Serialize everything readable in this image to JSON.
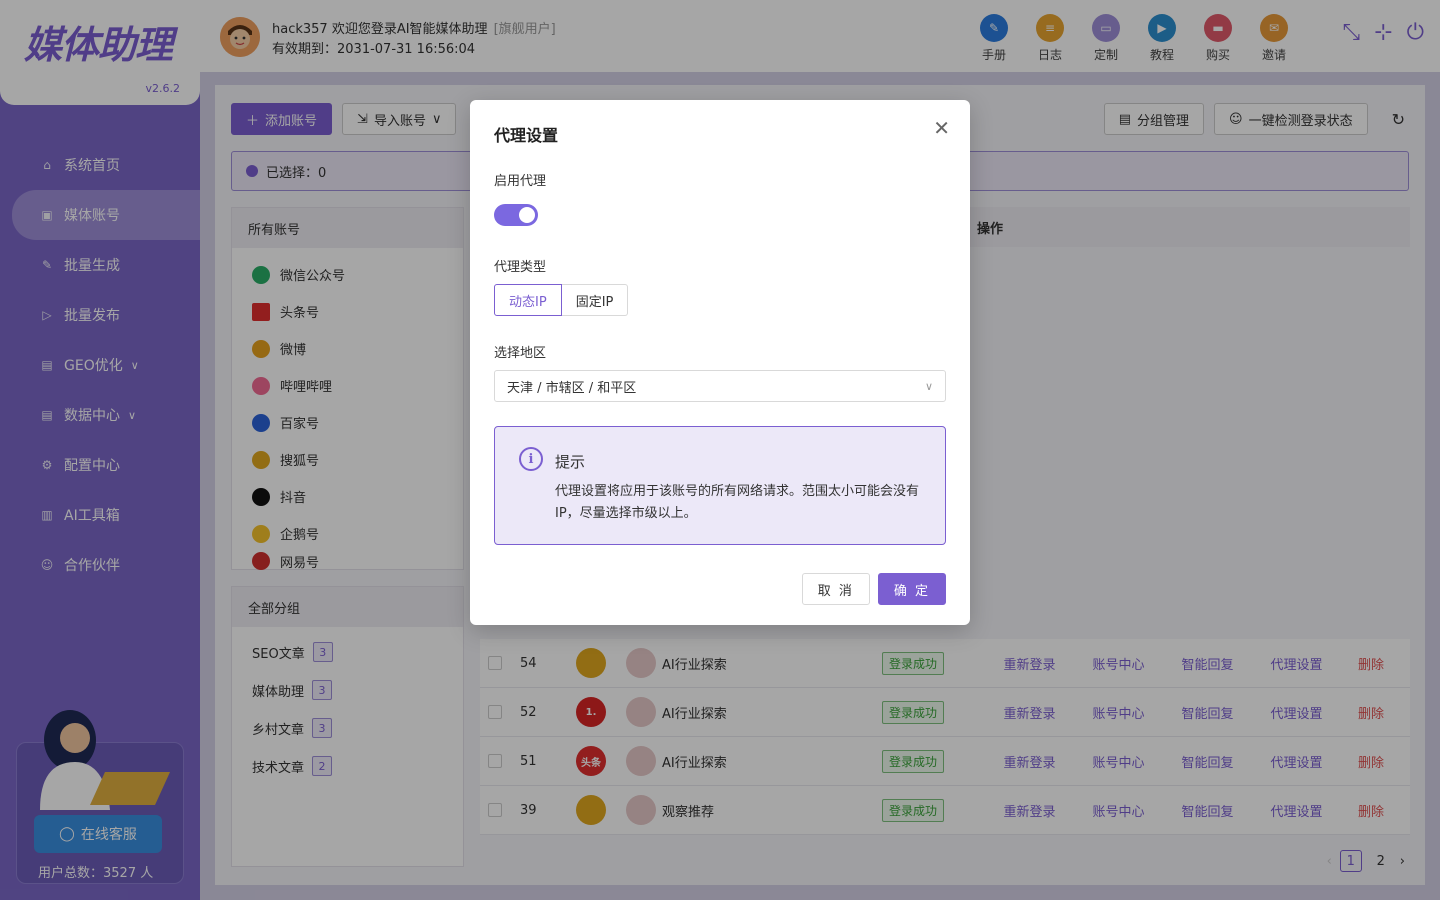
{
  "app": {
    "logo": "媒体助理",
    "version": "v2.6.2"
  },
  "sidebar": {
    "items": [
      {
        "label": "系统首页",
        "icon": "home-icon"
      },
      {
        "label": "媒体账号",
        "icon": "account-icon",
        "active": true
      },
      {
        "label": "批量生成",
        "icon": "edit-icon"
      },
      {
        "label": "批量发布",
        "icon": "send-icon"
      },
      {
        "label": "GEO优化",
        "icon": "doc-icon",
        "expandable": true
      },
      {
        "label": "数据中心",
        "icon": "data-icon",
        "expandable": true
      },
      {
        "label": "配置中心",
        "icon": "gear-icon"
      },
      {
        "label": "AI工具箱",
        "icon": "book-icon"
      },
      {
        "label": "合作伙伴",
        "icon": "partner-icon"
      }
    ],
    "support_button": "在线客服",
    "user_total": "用户总数：3527 人"
  },
  "header": {
    "welcome": "hack357 欢迎您登录AI智能媒体助理",
    "user_tag": "[旗舰用户]",
    "expire": "有效期到：2031-07-31 16:56:04",
    "icons": [
      {
        "label": "手册",
        "color": "#2b7de0"
      },
      {
        "label": "日志",
        "color": "#e8a530"
      },
      {
        "label": "定制",
        "color": "#9e8fd9"
      },
      {
        "label": "教程",
        "color": "#2b8fd0"
      },
      {
        "label": "购买",
        "color": "#e05a6a"
      },
      {
        "label": "邀请",
        "color": "#e89a3a"
      }
    ]
  },
  "toolbar": {
    "add_account": "添加账号",
    "import_account": "导入账号",
    "group_manage": "分组管理",
    "check_login": "一键检测登录状态"
  },
  "selection": {
    "text": "已选择：0"
  },
  "platforms": {
    "header": "所有账号",
    "items": [
      {
        "label": "微信公众号",
        "color": "#2aae67"
      },
      {
        "label": "头条号",
        "color": "#e02e2e"
      },
      {
        "label": "微博",
        "color": "#e6a21e"
      },
      {
        "label": "哔哩哔哩",
        "color": "#f26b94"
      },
      {
        "label": "百家号",
        "color": "#2b63d9"
      },
      {
        "label": "搜狐号",
        "color": "#e0a820"
      },
      {
        "label": "抖音",
        "color": "#111111"
      },
      {
        "label": "企鹅号",
        "color": "#f5c22b"
      },
      {
        "label": "网易号",
        "color": "#d0302e"
      }
    ]
  },
  "groups": {
    "header": "全部分组",
    "items": [
      {
        "label": "SEO文章",
        "count": "3"
      },
      {
        "label": "媒体助理",
        "count": "3"
      },
      {
        "label": "乡村文章",
        "count": "3"
      },
      {
        "label": "技术文章",
        "count": "2"
      }
    ]
  },
  "table": {
    "ops_header": "操作",
    "ops": [
      "重新登录",
      "账号中心",
      "智能回复",
      "代理设置",
      "删除"
    ],
    "rows": [
      {
        "id": "54",
        "name": "AI行业探索",
        "status": "登录成功",
        "plat_color": "#e0a820",
        "plat_text": ""
      },
      {
        "id": "52",
        "name": "AI行业探索",
        "status": "登录成功",
        "plat_color": "#d92626",
        "plat_text": "1."
      },
      {
        "id": "51",
        "name": "AI行业探索",
        "status": "登录成功",
        "plat_color": "#e02e2e",
        "plat_text": "头条"
      },
      {
        "id": "39",
        "name": "观察推荐",
        "status": "登录成功",
        "plat_color": "#e0a820",
        "plat_text": ""
      }
    ]
  },
  "pager": {
    "pages": [
      "1",
      "2"
    ],
    "current": "1"
  },
  "modal": {
    "title": "代理设置",
    "enable_label": "启用代理",
    "enabled": true,
    "type_label": "代理类型",
    "type_options": [
      "动态IP",
      "固定IP"
    ],
    "type_selected": "动态IP",
    "region_label": "选择地区",
    "region_value": "天津 / 市辖区 / 和平区",
    "tip_title": "提示",
    "tip_text": "代理设置将应用于该账号的所有网络请求。范围太小可能会没有IP，尽量选择市级以上。",
    "cancel": "取 消",
    "confirm": "确 定"
  }
}
